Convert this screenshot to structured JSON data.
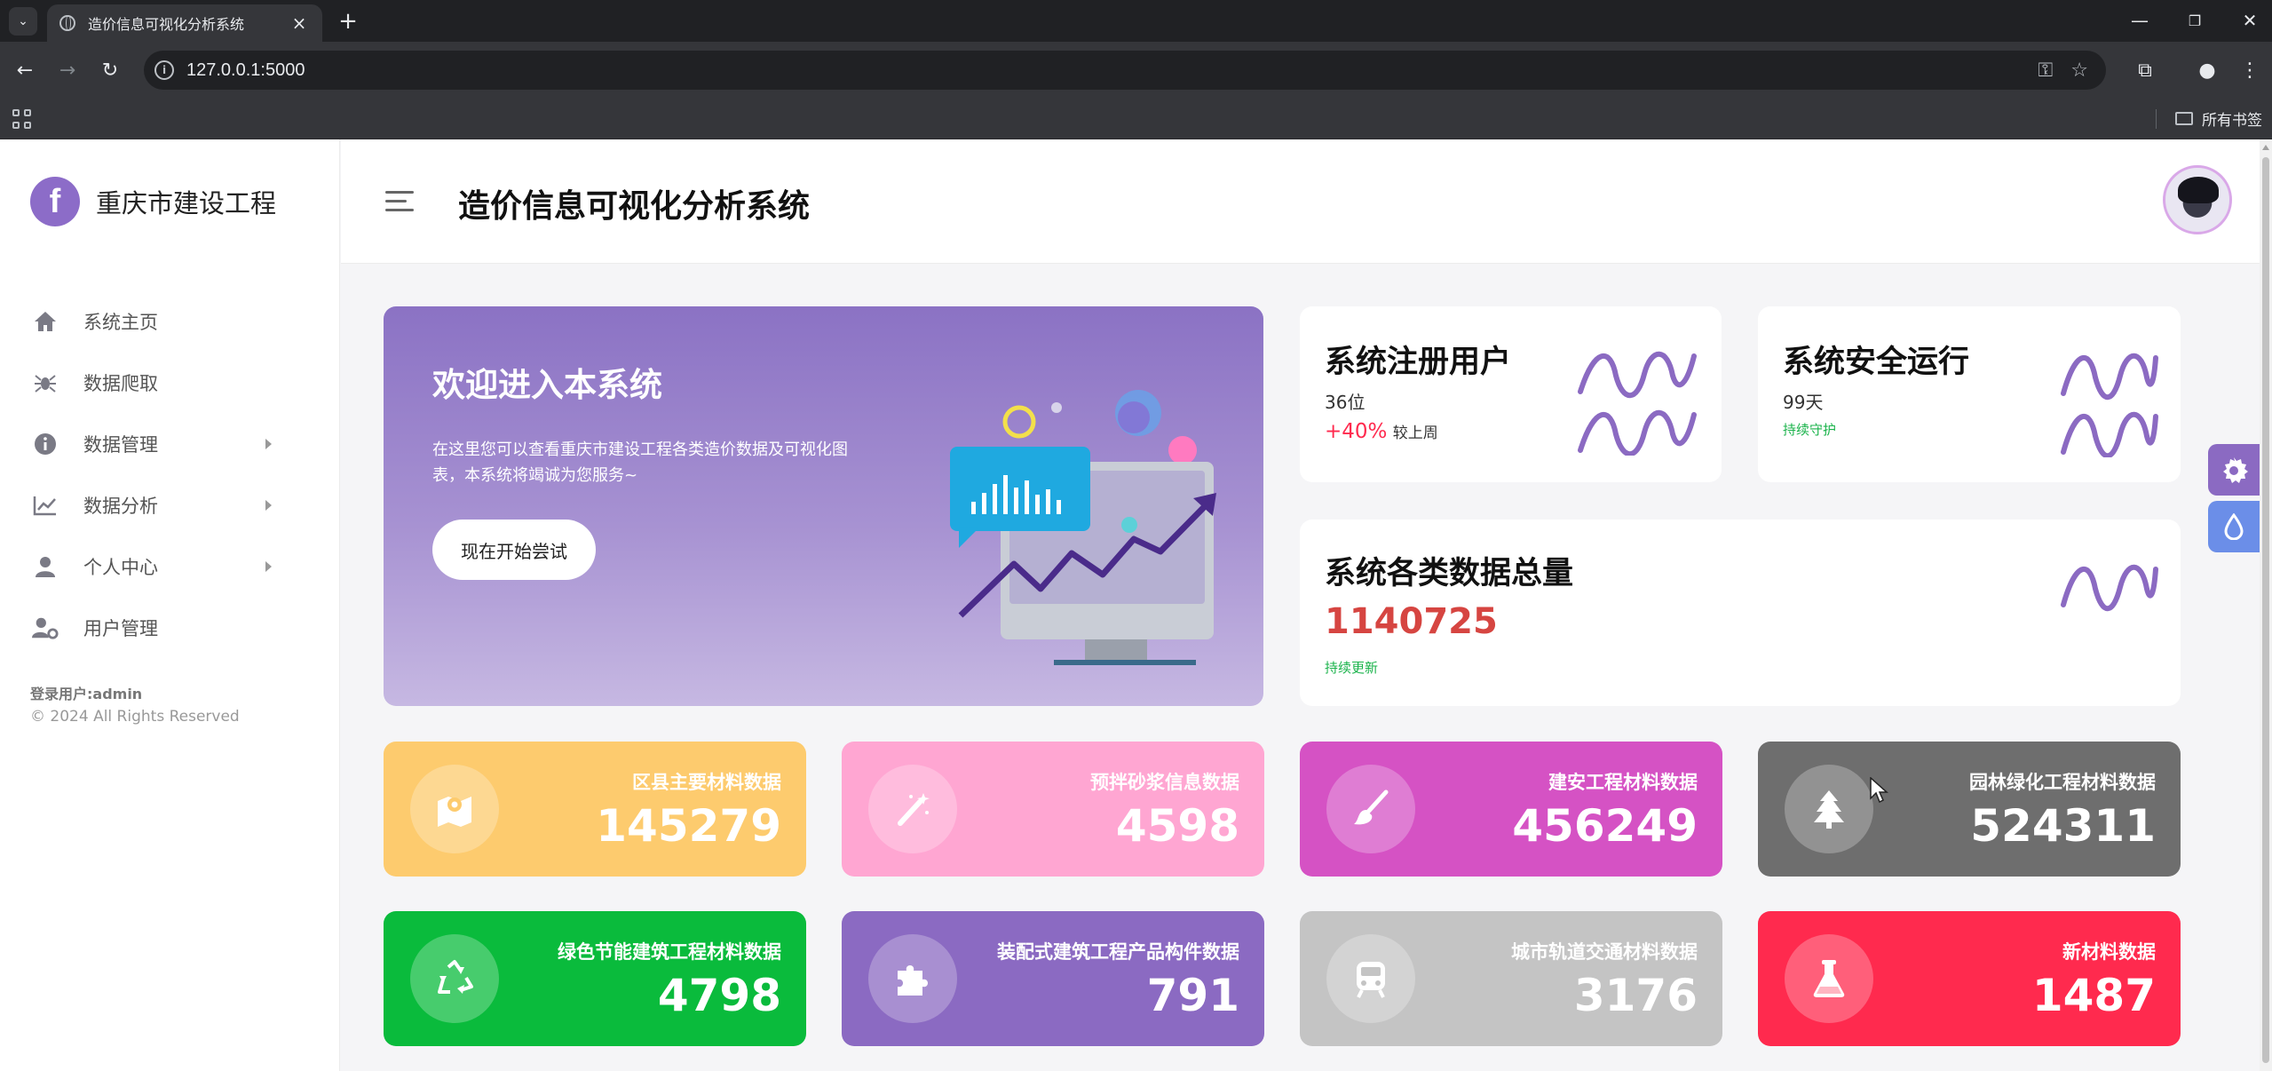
{
  "browser": {
    "tab_title": "造价信息可视化分析系统",
    "url": "127.0.0.1:5000",
    "bookmarks_label": "所有书签"
  },
  "sidebar": {
    "brand": "重庆市建设工程",
    "items": [
      {
        "label": "系统主页",
        "icon": "home-icon",
        "has_arrow": false
      },
      {
        "label": "数据爬取",
        "icon": "spider-icon",
        "has_arrow": false
      },
      {
        "label": "数据管理",
        "icon": "info-icon",
        "has_arrow": true
      },
      {
        "label": "数据分析",
        "icon": "chart-icon",
        "has_arrow": true
      },
      {
        "label": "个人中心",
        "icon": "user-icon",
        "has_arrow": true
      },
      {
        "label": "用户管理",
        "icon": "user-cog-icon",
        "has_arrow": false
      }
    ],
    "login_user": "登录用户:admin",
    "copyright": "© 2024 All Rights Reserved"
  },
  "header": {
    "title": "造价信息可视化分析系统"
  },
  "welcome": {
    "title": "欢迎进入本系统",
    "description": "在这里您可以查看重庆市建设工程各类造价数据及可视化图表，本系统将竭诚为您服务~",
    "button": "现在开始尝试"
  },
  "stats": {
    "users": {
      "title": "系统注册用户",
      "count": "36位",
      "change": "+40%",
      "change_label": "较上周"
    },
    "uptime": {
      "title": "系统安全运行",
      "days": "99天",
      "note": "持续守护"
    },
    "total": {
      "title": "系统各类数据总量",
      "value": "1140725",
      "note": "持续更新"
    }
  },
  "tiles": [
    {
      "label": "区县主要材料数据",
      "value": "145279",
      "color": "#fdcb6e",
      "icon": "map-icon"
    },
    {
      "label": "预拌砂浆信息数据",
      "value": "4598",
      "color": "#ffa6d2",
      "icon": "magic-wand-icon"
    },
    {
      "label": "建安工程材料数据",
      "value": "456249",
      "color": "#d552c4",
      "icon": "brush-icon"
    },
    {
      "label": "园林绿化工程材料数据",
      "value": "524311",
      "color": "#6e6e6e",
      "icon": "tree-icon"
    },
    {
      "label": "绿色节能建筑工程材料数据",
      "value": "4798",
      "color": "#0abb3c",
      "icon": "recycle-icon"
    },
    {
      "label": "装配式建筑工程产品构件数据",
      "value": "791",
      "color": "#8b6ac2",
      "icon": "puzzle-icon"
    },
    {
      "label": "城市轨道交通材料数据",
      "value": "3176",
      "color": "#c4c4c4",
      "icon": "train-icon"
    },
    {
      "label": "新材料数据",
      "value": "1487",
      "color": "#ff2a4e",
      "icon": "flask-icon"
    }
  ],
  "colors": {
    "brand": "#8c6cc8",
    "wave": "#8b6ac2",
    "positive": "#ff2a4e",
    "success": "#1ab34b",
    "total_value": "#d64541"
  }
}
